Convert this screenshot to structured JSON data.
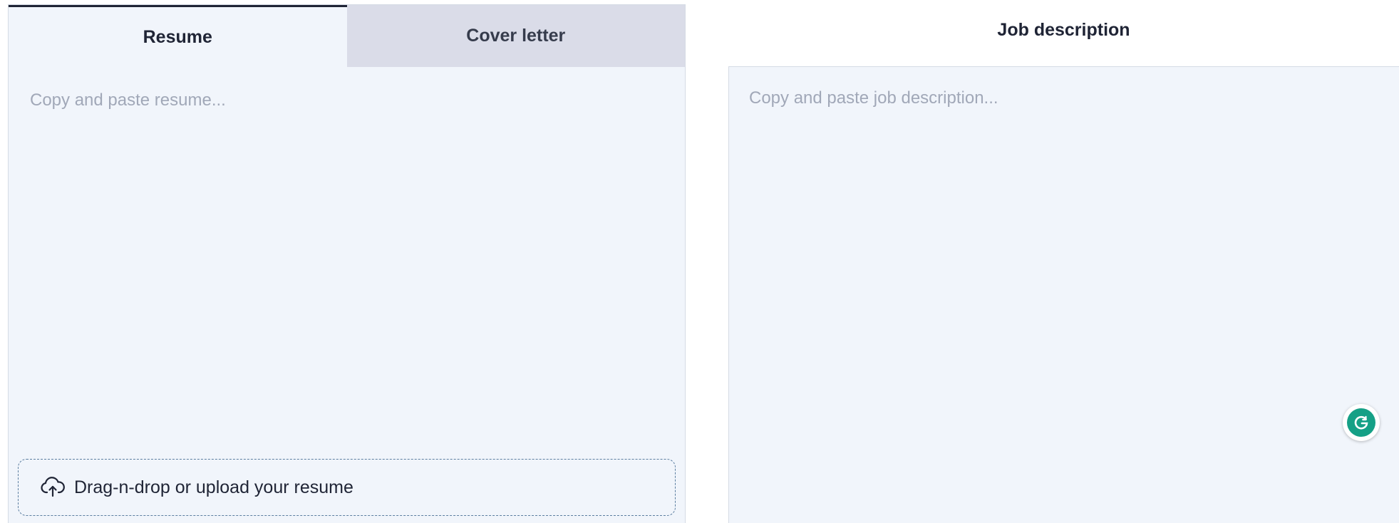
{
  "left_panel": {
    "tabs": [
      {
        "label": "Resume",
        "active": true
      },
      {
        "label": "Cover letter",
        "active": false
      }
    ],
    "resume_placeholder": "Copy and paste resume...",
    "upload": {
      "icon": "cloud-upload-icon",
      "label": "Drag-n-drop or upload your resume"
    }
  },
  "right_panel": {
    "title": "Job description",
    "placeholder": "Copy and paste job description..."
  },
  "grammarly": {
    "icon": "grammarly-icon",
    "color": "#15a086"
  },
  "colors": {
    "panel_bg": "#f1f5fb",
    "inactive_tab_bg": "#dadce8",
    "upload_border": "#5b7ea0"
  }
}
